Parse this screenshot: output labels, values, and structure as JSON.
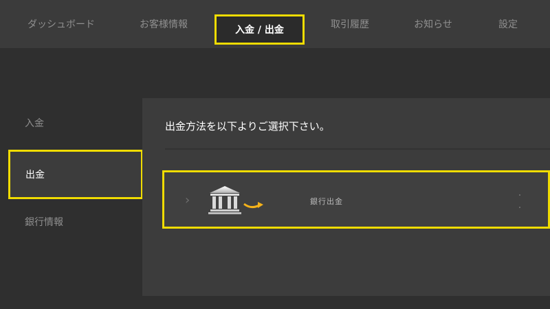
{
  "nav": {
    "tabs": [
      {
        "label": "ダッシュボード"
      },
      {
        "label": "お客様情報"
      },
      {
        "label": "入金 / 出金",
        "active": true
      },
      {
        "label": "取引履歴"
      },
      {
        "label": "お知らせ"
      },
      {
        "label": "設定"
      }
    ]
  },
  "sidebar": {
    "items": [
      {
        "label": "入金"
      },
      {
        "label": "出金",
        "active": true
      },
      {
        "label": "銀行情報"
      }
    ]
  },
  "main": {
    "instruction": "出金方法を以下よりご選択下さい。",
    "methods": [
      {
        "label": "銀行出金",
        "icon": "bank-icon"
      }
    ]
  },
  "colors": {
    "highlight": "#f0dc00",
    "arrow": "#f5b21a",
    "background": "#2f2f2f"
  }
}
